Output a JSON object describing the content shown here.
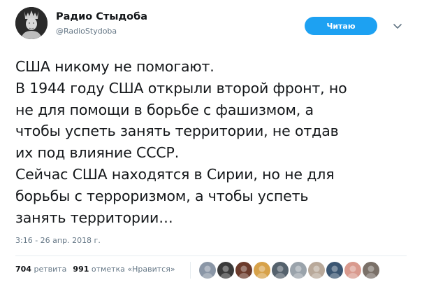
{
  "author": {
    "name": "Радио Стыдоба",
    "handle": "@RadioStydoba"
  },
  "follow_button": {
    "label": "Читаю"
  },
  "tweet": {
    "lines": [
      "США никому не помогают.",
      "В 1944 году США открыли второй фронт, но",
      "не для помощи в борьбе с фашизмом, а",
      "чтобы успеть занять территории, не отдав",
      "их под влияние СССР.",
      "Сейчас США находятся в Сирии, но не для",
      "борьбы с терроризмом, а чтобы успеть",
      "занять территории…"
    ]
  },
  "timestamp": "3:16 - 26 апр. 2018 г.",
  "stats": {
    "retweets_count": "704",
    "retweets_label": "ретвита",
    "likes_count": "991",
    "likes_label": "отметка «Нравится»"
  },
  "colors": {
    "accent": "#1da1f2",
    "text": "#14171a",
    "secondary": "#657786",
    "divider": "#e6ecf0"
  },
  "icons": {
    "avatar": "statue-avatar",
    "chevron": "chevron-down-icon"
  },
  "liker_avatars": [
    {
      "name": "liker-avatar-1",
      "color": "#8a96a6"
    },
    {
      "name": "liker-avatar-2",
      "color": "#3a3a3a"
    },
    {
      "name": "liker-avatar-3",
      "color": "#6b3b2c"
    },
    {
      "name": "liker-avatar-4",
      "color": "#d7a24a"
    },
    {
      "name": "liker-avatar-5",
      "color": "#55626d"
    },
    {
      "name": "liker-avatar-6",
      "color": "#9aa3ab"
    },
    {
      "name": "liker-avatar-7",
      "color": "#b9a99a"
    },
    {
      "name": "liker-avatar-8",
      "color": "#3b5672"
    },
    {
      "name": "liker-avatar-9",
      "color": "#d99a8e"
    },
    {
      "name": "liker-avatar-10",
      "color": "#7a7068"
    }
  ]
}
